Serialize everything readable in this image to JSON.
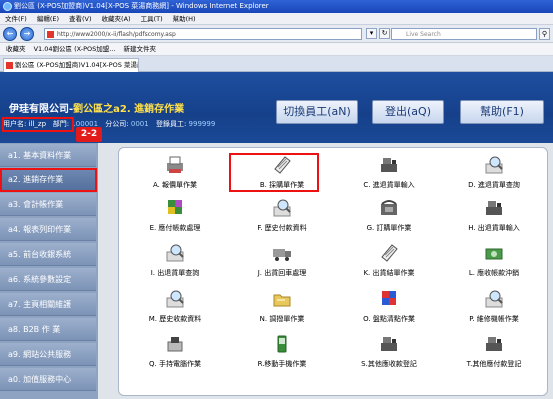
{
  "window": {
    "title": "劉公區 (X-POS加盟商)V1.04[X-POS 菜湯商務網] - Windows Internet Explorer",
    "menu": [
      "文件(F)",
      "編輯(E)",
      "查看(V)",
      "收藏夾(A)",
      "工具(T)",
      "幫助(H)"
    ],
    "address": "http://www2000/x-ii/flash/pdfscomy.asp",
    "search_placeholder": "Live Search",
    "favorites": [
      "收藏夾",
      "V1.04劉公區 (X-POS加盟...",
      "新建文件夾"
    ],
    "tab_title": "劉公區 (X-POS加盟商)V1.04[X-POS 菜湯商務網]"
  },
  "header": {
    "company": "伊珪有限公司-",
    "module": "劉公區之a2. 進銷存作業",
    "user_label": "用户名: ill_zp",
    "dept_label": "部門:",
    "dept_value": "100001",
    "branch_label": "分公司:",
    "branch_value": "0001",
    "staff_label": "登錄員工:",
    "staff_value": "999999",
    "btn_switch": "切換員工(aN)",
    "btn_logout": "登出(aQ)",
    "btn_help": "幫助(F1)",
    "callout": "2-2"
  },
  "sidebar": [
    {
      "label": "a1. 基本資料作業"
    },
    {
      "label": "a2. 進銷存作業"
    },
    {
      "label": "a3. 會計帳作業"
    },
    {
      "label": "a4. 報表列印作業"
    },
    {
      "label": "a5. 前台收銀系統"
    },
    {
      "label": "a6. 系統參數設定"
    },
    {
      "label": "a7. 主頁相關維護"
    },
    {
      "label": "a8. B2B 作 業"
    },
    {
      "label": "a9. 網站公共服務"
    },
    {
      "label": "a0. 加值服務中心"
    }
  ],
  "functions": [
    {
      "label": "A. 報價單作業",
      "icon": "printer-icon"
    },
    {
      "label": "B. 採購單作業",
      "icon": "document-icon"
    },
    {
      "label": "C. 進退貨單輸入",
      "icon": "cash-register-icon"
    },
    {
      "label": "D. 進退貨單查詢",
      "icon": "search-icon"
    },
    {
      "label": "E. 應付帳款處理",
      "icon": "grid-icon"
    },
    {
      "label": "F. 歷史付款資料",
      "icon": "search-icon"
    },
    {
      "label": "G. 訂購單作業",
      "icon": "phone-icon"
    },
    {
      "label": "H. 出退貨單輸入",
      "icon": "cash-register-icon"
    },
    {
      "label": "I. 出退貨單查詢",
      "icon": "search-icon"
    },
    {
      "label": "J. 出貨回車處理",
      "icon": "truck-icon"
    },
    {
      "label": "K. 出貨結單作業",
      "icon": "document-icon"
    },
    {
      "label": "L. 應收帳款沖銷",
      "icon": "cash-icon"
    },
    {
      "label": "M. 歷史收款資料",
      "icon": "search-icon"
    },
    {
      "label": "N. 調撥單作業",
      "icon": "folder-icon"
    },
    {
      "label": "O. 盤點清點作業",
      "icon": "blocks-icon"
    },
    {
      "label": "P. 維修機帳作業",
      "icon": "search-icon"
    },
    {
      "label": "Q. 手持電腦作業",
      "icon": "handheld-icon"
    },
    {
      "label": "R.移動手機作業",
      "icon": "mobile-icon"
    },
    {
      "label": "S.其他應收款登記",
      "icon": "cash-register-icon"
    },
    {
      "label": "T.其他應付款登記",
      "icon": "cash-register-icon"
    }
  ],
  "colors": {
    "header_bg": "#1d4fa0",
    "highlight": "#e11111",
    "module_text": "#ffe04a"
  }
}
